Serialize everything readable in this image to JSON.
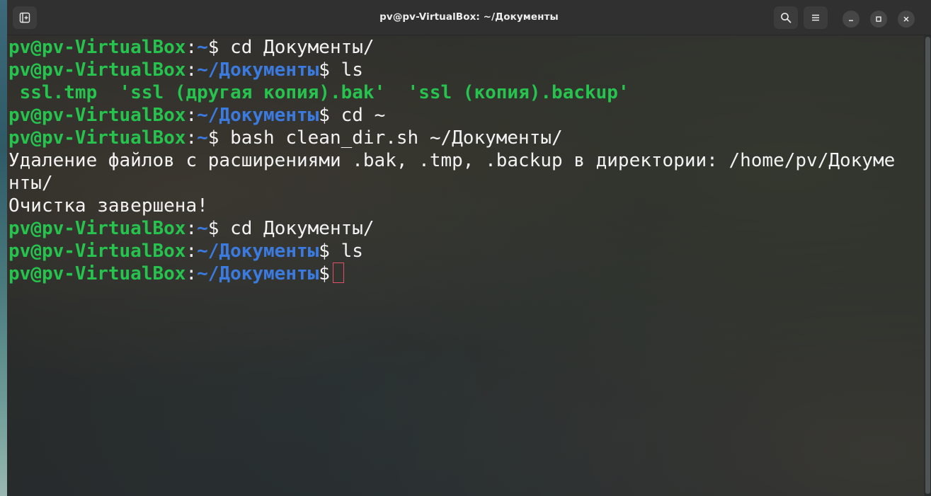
{
  "window": {
    "title": "pv@pv-VirtualBox: ~/Документы",
    "buttons": {
      "new_tab_icon": "new-tab-icon",
      "search_icon": "search-icon",
      "menu_icon": "hamburger-menu-icon",
      "minimize_icon": "minimize-icon",
      "maximize_icon": "maximize-icon",
      "close_icon": "close-icon"
    }
  },
  "colors": {
    "prompt_user": "#26c44e",
    "prompt_path": "#3b7be0",
    "text": "#f2f2f2",
    "cursor": "#e0506a",
    "titlebar": "#303030"
  },
  "terminal": {
    "lines": [
      {
        "user": "pv@pv-VirtualBox",
        "colon": ":",
        "path": "~",
        "dollar": "$",
        "cmd": " cd Документы/"
      },
      {
        "user": "pv@pv-VirtualBox",
        "colon": ":",
        "path": "~/Документы",
        "dollar": "$",
        "cmd": " ls"
      },
      {
        "files": [
          " ssl.tmp",
          "  'ssl (другая копия).bak'",
          "  'ssl (копия).backup'"
        ]
      },
      {
        "user": "pv@pv-VirtualBox",
        "colon": ":",
        "path": "~/Документы",
        "dollar": "$",
        "cmd": " cd ~"
      },
      {
        "user": "pv@pv-VirtualBox",
        "colon": ":",
        "path": "~",
        "dollar": "$",
        "cmd": " bash clean_dir.sh ~/Документы/"
      },
      {
        "text": "Удаление файлов с расширениями .bak, .tmp, .backup в директории: /home/pv/Докуме"
      },
      {
        "text": "нты/"
      },
      {
        "text": "Очистка завершена!"
      },
      {
        "user": "pv@pv-VirtualBox",
        "colon": ":",
        "path": "~",
        "dollar": "$",
        "cmd": " cd Документы/"
      },
      {
        "user": "pv@pv-VirtualBox",
        "colon": ":",
        "path": "~/Документы",
        "dollar": "$",
        "cmd": " ls"
      },
      {
        "user": "pv@pv-VirtualBox",
        "colon": ":",
        "path": "~/Документы",
        "dollar": "$",
        "cmd": " "
      }
    ]
  }
}
